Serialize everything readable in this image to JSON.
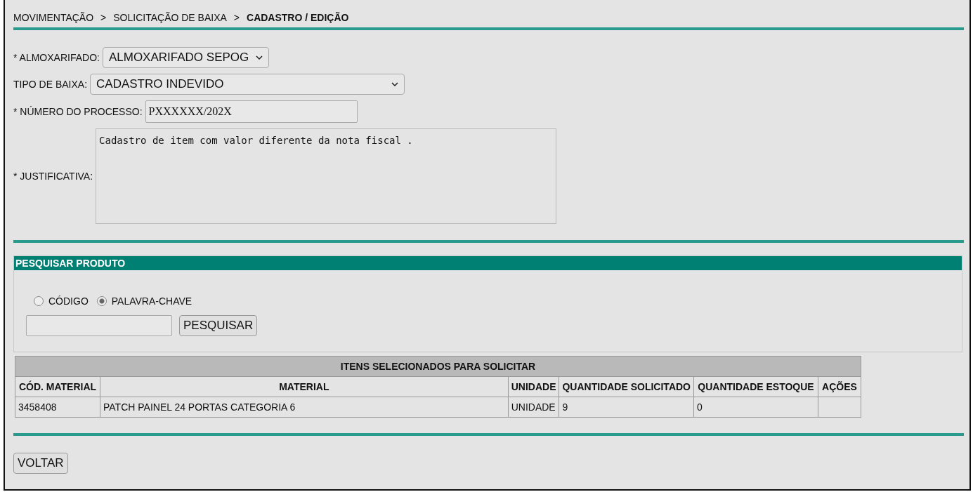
{
  "breadcrumb": [
    {
      "label": "MOVIMENTAÇÃO",
      "current": false
    },
    {
      "label": "SOLICITAÇÃO DE BAIXA",
      "current": false
    },
    {
      "label": "CADASTRO / EDIÇÃO",
      "current": true
    }
  ],
  "breadcrumb_separator": ">",
  "form": {
    "almoxarifado": {
      "label": "* ALMOXARIFADO:",
      "value": "ALMOXARIFADO SEPOG"
    },
    "tipo_baixa": {
      "label": "TIPO DE BAIXA:",
      "value": "CADASTRO INDEVIDO"
    },
    "numero_processo": {
      "label": "* NÚMERO DO PROCESSO:",
      "value": "PXXXXXX/202X"
    },
    "justificativa": {
      "label": "* JUSTIFICATIVA:",
      "value": "Cadastro de item com valor diferente da nota fiscal ."
    }
  },
  "search_panel": {
    "title": "PESQUISAR PRODUTO",
    "options": [
      {
        "label": "CÓDIGO",
        "selected": false
      },
      {
        "label": "PALAVRA-CHAVE",
        "selected": true
      }
    ],
    "button": "PESQUISAR"
  },
  "table": {
    "title": "ITENS SELECIONADOS PARA SOLICITAR",
    "columns": [
      "CÓD. MATERIAL",
      "MATERIAL",
      "UNIDADE",
      "QUANTIDADE SOLICITADO",
      "QUANTIDADE ESTOQUE",
      "AÇÕES"
    ],
    "rows": [
      [
        "3458408",
        "PATCH PAINEL 24 PORTAS CATEGORIA 6",
        "UNIDADE",
        "9",
        "0",
        ""
      ]
    ]
  },
  "back_button": "VOLTAR"
}
